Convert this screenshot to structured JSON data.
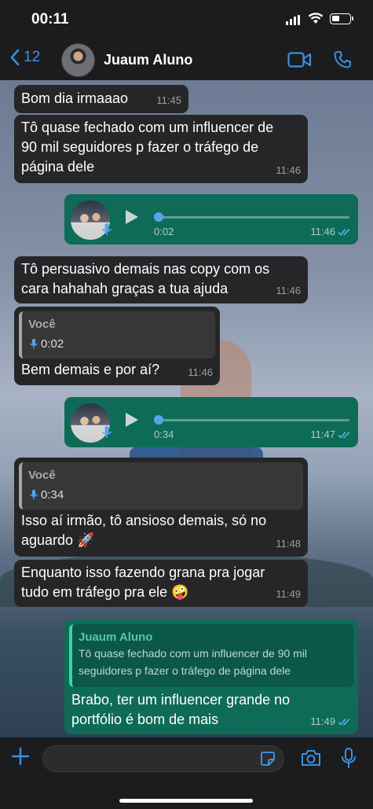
{
  "status_bar": {
    "time": "00:11"
  },
  "header": {
    "back_count": "12",
    "contact_name": "Juaum Aluno"
  },
  "messages": [
    {
      "text": "Bom dia irmaaao",
      "time": "11:45"
    },
    {
      "text_lines": [
        "Tô quase fechado com um influencer de",
        "90 mil seguidores p fazer o tráfego de",
        "página dele"
      ],
      "time": "11:46"
    },
    {
      "voice_duration": "0:02",
      "time": "11:46"
    },
    {
      "text_lines": [
        "Tô persuasivo demais nas copy com os",
        "cara hahahah graças a tua ajuda"
      ],
      "time": "11:46"
    },
    {
      "quote_name": "Você",
      "quote_duration": "0:02",
      "text": "Bem demais e por aí?",
      "time": "11:46"
    },
    {
      "voice_duration": "0:34",
      "time": "11:47"
    },
    {
      "quote_name": "Você",
      "quote_duration": "0:34",
      "text_lines": [
        "Isso aí irmão, tô ansioso demais, só no",
        "aguardo 🚀"
      ],
      "time": "11:48"
    },
    {
      "text_lines": [
        "Enquanto isso fazendo grana pra jogar",
        "tudo em tráfego pra ele 🤪"
      ],
      "time": "11:49"
    },
    {
      "quote_name": "Juaum Aluno",
      "quote_lines": [
        "Tô quase fechado com um influencer de 90 mil",
        "seguidores p fazer o tráfego de página dele"
      ],
      "text_lines": [
        "Brabo, ter um influencer grande no",
        "portfólio é bom de mais"
      ],
      "time": "11:49"
    }
  ],
  "colors": {
    "accent": "#3d8fe0",
    "outgoing_bubble": "#0e6b58",
    "incoming_bubble": "#262628",
    "read_ticks": "#53bdeb"
  },
  "icons": [
    "back-chevron-icon",
    "video-call-icon",
    "phone-icon",
    "play-icon",
    "mic-icon",
    "double-check-icon",
    "plus-icon",
    "sticker-icon",
    "camera-icon"
  ]
}
